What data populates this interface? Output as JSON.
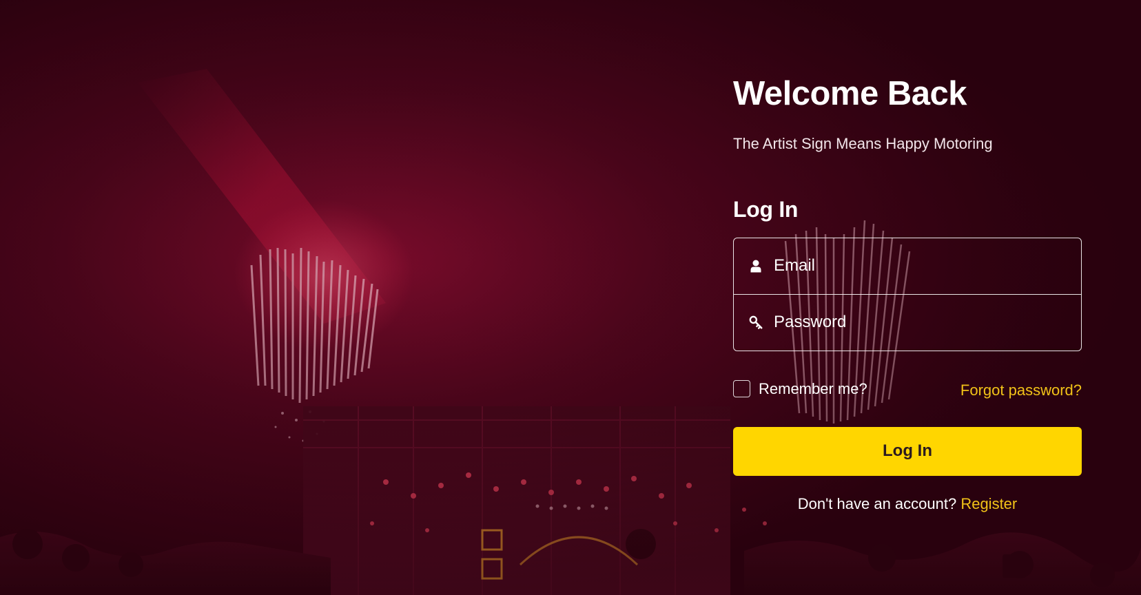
{
  "welcome": {
    "title": "Welcome Back",
    "subtitle": "The Artist Sign Means Happy Motoring"
  },
  "login_form": {
    "heading": "Log In",
    "email": {
      "placeholder": "Email",
      "value": "",
      "icon": "user-icon"
    },
    "password": {
      "placeholder": "Password",
      "value": "",
      "icon": "key-icon"
    },
    "remember_me": {
      "label": "Remember me?",
      "checked": false
    },
    "forgot_password_label": "Forgot password?",
    "submit_label": "Log In",
    "register_prompt": "Don't have an account?",
    "register_label": "Register"
  },
  "colors": {
    "background": "#3a0416",
    "accent_yellow": "#ffd600",
    "link_yellow": "#f2c318",
    "text": "#ffffff"
  }
}
